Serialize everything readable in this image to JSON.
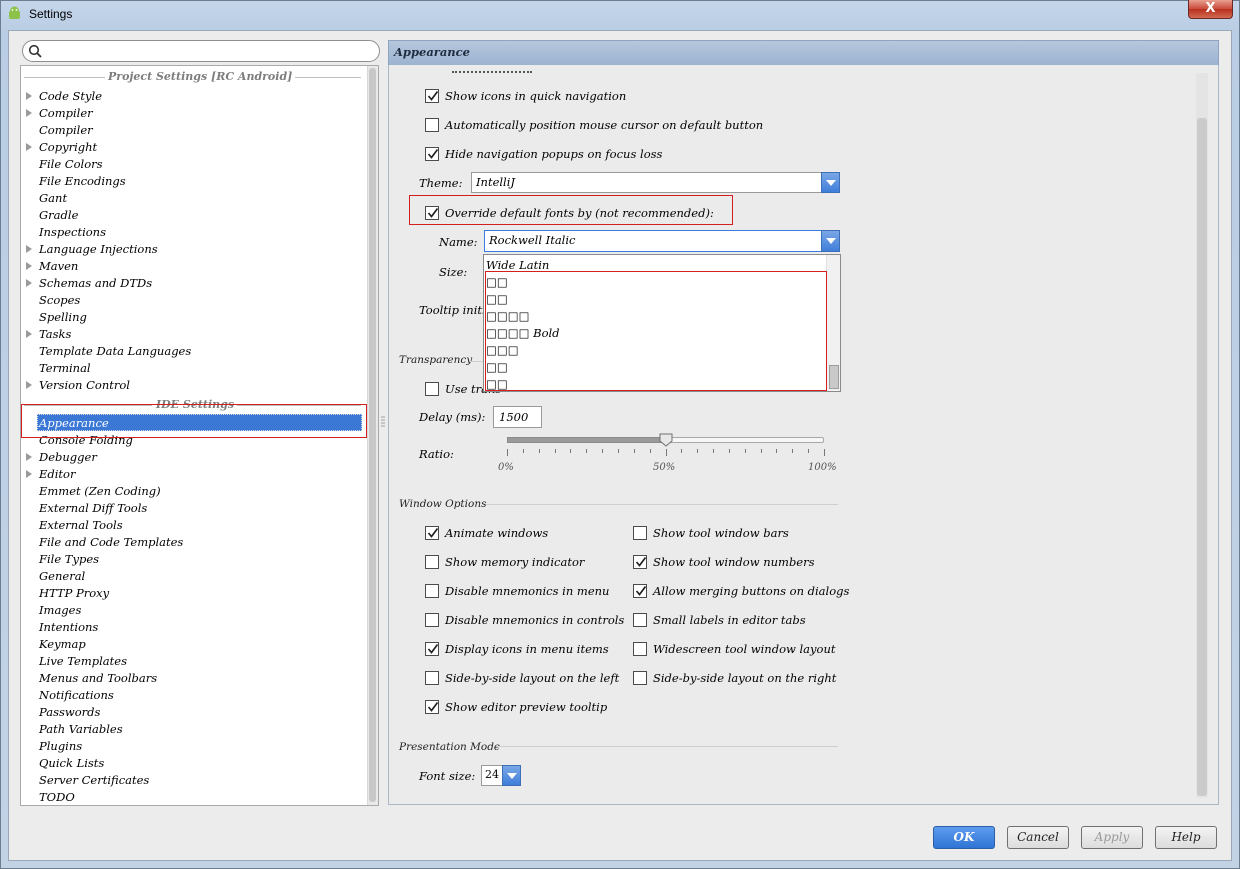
{
  "window": {
    "title": "Settings",
    "close_label": "X"
  },
  "search": {
    "placeholder": ""
  },
  "tree": {
    "project_group": "Project Settings [RC Android]",
    "ide_group": "IDE Settings",
    "project_items": [
      "Code Style",
      "Compiler",
      "Compiler",
      "Copyright",
      "File Colors",
      "File Encodings",
      "Gant",
      "Gradle",
      "Inspections",
      "Language Injections",
      "Maven",
      "Schemas and DTDs",
      "Scopes",
      "Spelling",
      "Tasks",
      "Template Data Languages",
      "Terminal",
      "Version Control"
    ],
    "ide_items": [
      "Appearance",
      "Console Folding",
      "Debugger",
      "Editor",
      "Emmet (Zen Coding)",
      "External Diff Tools",
      "External Tools",
      "File and Code Templates",
      "File Types",
      "General",
      "HTTP Proxy",
      "Images",
      "Intentions",
      "Keymap",
      "Live Templates",
      "Menus and Toolbars",
      "Notifications",
      "Passwords",
      "Path Variables",
      "Plugins",
      "Quick Lists",
      "Server Certificates",
      "TODO"
    ]
  },
  "panel": {
    "title": "Appearance",
    "show_icons_quick_nav": "Show icons in quick navigation",
    "auto_position_mouse": "Automatically position mouse cursor on default button",
    "hide_nav_popups": "Hide navigation popups on focus loss",
    "theme_label": "Theme:",
    "theme_value": "IntelliJ",
    "override_fonts": "Override default fonts by (not recommended):",
    "name_label": "Name:",
    "name_value": "Rockwell Italic",
    "size_label": "Size:",
    "tooltip_label": "Tooltip initi",
    "font_options": [
      "Wide Latin",
      "□□",
      "□□",
      "□□□□",
      "□□□□ Bold",
      "□□□",
      "□□",
      "□□"
    ],
    "transparency_section": "Transparency",
    "use_transparent": "Use trans",
    "delay_label": "Delay (ms):",
    "delay_value": "1500",
    "ratio_label": "Ratio:",
    "ratio_ticks": [
      "0%",
      "50%",
      "100%"
    ],
    "ratio_value": 0.5,
    "window_options_section": "Window Options",
    "animate_windows": "Animate windows",
    "show_memory": "Show memory indicator",
    "disable_mnemonics_menu": "Disable mnemonics in menu",
    "disable_mnemonics_controls": "Disable mnemonics in controls",
    "display_icons_menu": "Display icons in menu items",
    "side_by_side_left": "Side-by-side layout on the left",
    "show_editor_preview": "Show editor preview tooltip",
    "show_tool_window_bars": "Show tool window bars",
    "show_tool_window_numbers": "Show tool window numbers",
    "allow_merging_buttons": "Allow merging buttons on dialogs",
    "small_labels": "Small labels in editor tabs",
    "widescreen_layout": "Widescreen tool window layout",
    "side_by_side_right": "Side-by-side layout on the right",
    "presentation_section": "Presentation Mode",
    "font_size_label": "Font size:",
    "font_size_value": "24"
  },
  "checks": {
    "show_icons_quick_nav": true,
    "auto_position_mouse": false,
    "hide_nav_popups": true,
    "override_fonts": true,
    "use_transparent": false,
    "animate_windows": true,
    "show_memory": false,
    "disable_mnemonics_menu": false,
    "disable_mnemonics_controls": false,
    "display_icons_menu": true,
    "side_by_side_left": false,
    "show_editor_preview": true,
    "show_tool_window_bars": false,
    "show_tool_window_numbers": true,
    "allow_merging_buttons": true,
    "small_labels": false,
    "widescreen_layout": false,
    "side_by_side_right": false
  },
  "buttons": {
    "ok": "OK",
    "cancel": "Cancel",
    "apply": "Apply",
    "help": "Help"
  },
  "colors": {
    "selection": "#3b78d6",
    "highlight_box": "#d21f1f",
    "primary_button": "#2f74d4"
  }
}
